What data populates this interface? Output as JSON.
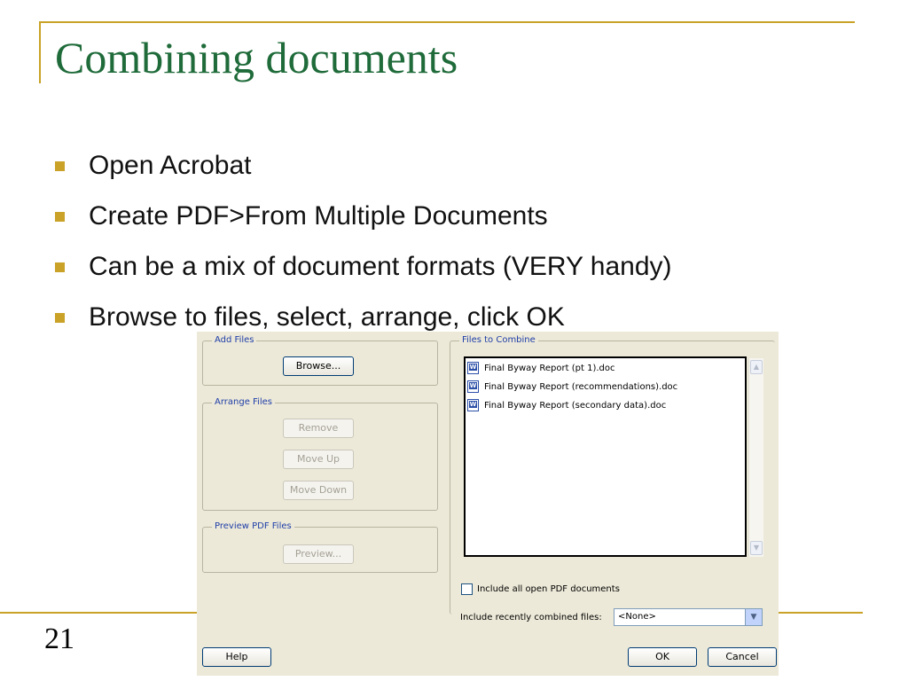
{
  "slide": {
    "title": "Combining documents",
    "page_number": "21",
    "bullets": [
      "Open Acrobat",
      "Create PDF>From Multiple Documents",
      "Can be a mix of document formats (VERY handy)",
      "Browse to files, select, arrange, click OK"
    ],
    "accent_color": "#c9a227",
    "title_color": "#1f6b3a"
  },
  "dialog": {
    "add_files": {
      "label": "Add Files",
      "browse": "Browse..."
    },
    "arrange_files": {
      "label": "Arrange Files",
      "remove": "Remove",
      "move_up": "Move Up",
      "move_down": "Move Down"
    },
    "preview_pdf": {
      "label": "Preview PDF Files",
      "preview": "Preview..."
    },
    "files_to_combine": {
      "label": "Files to Combine",
      "files": [
        "Final Byway Report (pt 1).doc",
        "Final Byway Report (recommendations).doc",
        "Final Byway Report (secondary data).doc"
      ],
      "file_icon": "word-document-icon"
    },
    "include_open_pdf": {
      "label": "Include all open PDF documents",
      "checked": false
    },
    "recent": {
      "label": "Include recently combined files:",
      "value": "<None>"
    },
    "footer": {
      "help": "Help",
      "ok": "OK",
      "cancel": "Cancel"
    }
  }
}
